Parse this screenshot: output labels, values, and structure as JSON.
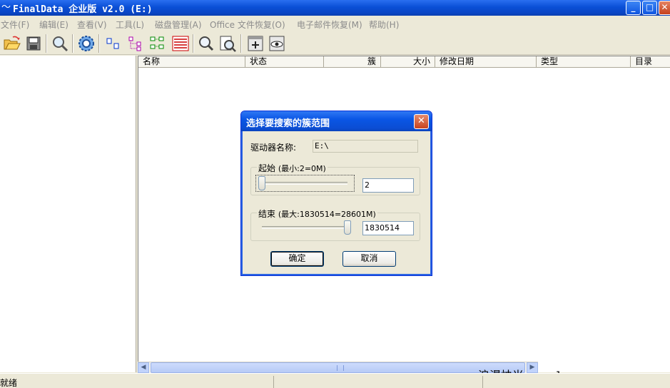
{
  "window": {
    "title": "FinalData 企业版 v2.0 (E:)",
    "app_icon": "finaldata-app-icon",
    "controls": {
      "minimize": "_",
      "maximize": "□",
      "close": "✕"
    }
  },
  "menubar": {
    "items": [
      "文件(F)",
      "编辑(E)",
      "查看(V)",
      "工具(L)",
      "磁盘管理(A)",
      "Office 文件恢复(O)",
      "电子邮件恢复(M)",
      "帮助(H)"
    ]
  },
  "toolbar": {
    "buttons": [
      "open-folder-icon",
      "save-disk-icon",
      "search-magnifier-icon",
      "settings-gear-icon",
      "list-small-icon",
      "tree-view-icon",
      "details-view-icon",
      "report-list-icon",
      "zoom-find-icon",
      "file-preview-icon",
      "add-window-icon",
      "view-eye-icon"
    ]
  },
  "file_list": {
    "columns": [
      "名称",
      "状态",
      "簇",
      "大小",
      "修改日期",
      "类型",
      "目录"
    ]
  },
  "statusbar": {
    "text": "就绪"
  },
  "watermark": {
    "cn": "浪漫烛光",
    "url": "www.langmanzg.com"
  },
  "dialog": {
    "title": "选择要搜索的簇范围",
    "close_glyph": "✕",
    "drive_label": "驱动器名称:",
    "drive_value": "E:\\",
    "start": {
      "legend": "起始",
      "hint": "(最小:2=0M)",
      "value": "2",
      "slider_fraction": 0.0
    },
    "end": {
      "legend": "结束",
      "hint": "(最大:1830514=28601M)",
      "value": "1830514",
      "slider_fraction": 1.0
    },
    "ok_label": "确定",
    "cancel_label": "取消"
  },
  "colors": {
    "titlebar": "#0a4fd6",
    "window_bg": "#ece9d8",
    "close_red": "#c8431f"
  }
}
